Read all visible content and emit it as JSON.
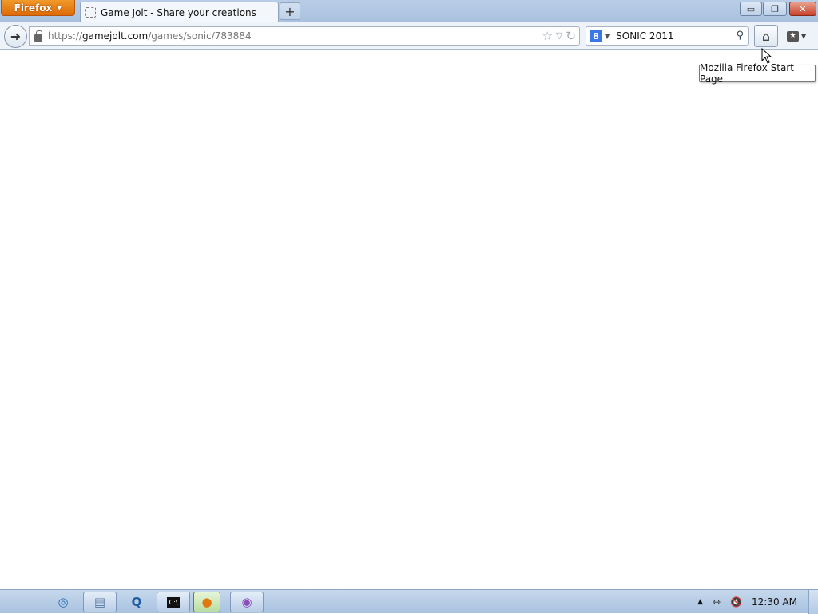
{
  "browser": {
    "menu_label": "Firefox",
    "tab": {
      "title": "Game Jolt - Share your creations"
    },
    "new_tab_label": "+",
    "window_controls": {
      "minimize": "▭",
      "maximize": "❐",
      "close": "✕"
    }
  },
  "navbar": {
    "url": {
      "protocol": "https://",
      "host": "gamejolt.com",
      "path": "/games/sonic/783884"
    },
    "search": {
      "engine_icon": "8",
      "query": "SONIC 2011"
    }
  },
  "tooltip": {
    "text": "Mozilla Firefox Start Page"
  },
  "taskbar": {
    "clock": "12:30 AM"
  },
  "colors": {
    "firefox_orange": "#e0780f",
    "titlebar": "#b3c9e3",
    "taskbar": "#b9cde6"
  }
}
